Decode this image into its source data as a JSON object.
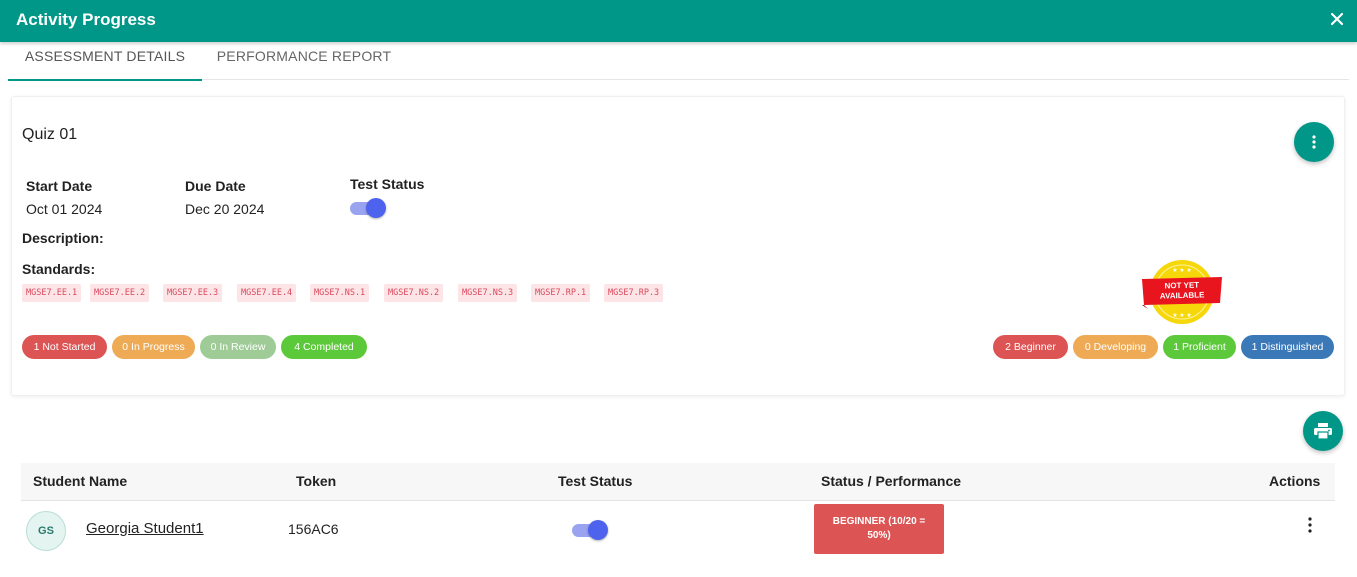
{
  "dialog": {
    "title": "Activity Progress",
    "close_icon": "close-icon"
  },
  "tabs": [
    {
      "label": "ASSESSMENT DETAILS",
      "active": true
    },
    {
      "label": "PERFORMANCE REPORT",
      "active": false
    }
  ],
  "assessment": {
    "title": "Quiz 01",
    "start_date_label": "Start Date",
    "start_date": "Oct 01 2024",
    "due_date_label": "Due Date",
    "due_date": "Dec 20 2024",
    "test_status_label": "Test Status",
    "test_status_on": true,
    "description_label": "Description:",
    "standards_label": "Standards:",
    "standards": [
      "MGSE7.EE.1",
      "MGSE7.EE.2",
      "MGSE7.EE.3",
      "MGSE7.EE.4",
      "MGSE7.NS.1",
      "MGSE7.NS.2",
      "MGSE7.NS.3",
      "MGSE7.RP.1",
      "MGSE7.RP.3"
    ],
    "badge": {
      "line1": "NOT YET",
      "line2": "AVAILABLE"
    }
  },
  "progress_counts": [
    {
      "label": "1 Not Started",
      "color": "#dc5454"
    },
    {
      "label": "0 In Progress",
      "color": "#eeaa55"
    },
    {
      "label": "0 In Review",
      "color": "#9ecb96"
    },
    {
      "label": "4 Completed",
      "color": "#5cc93a"
    }
  ],
  "performance_counts": [
    {
      "label": "2 Beginner",
      "color": "#dc5454"
    },
    {
      "label": "0 Developing",
      "color": "#eeaa55"
    },
    {
      "label": "1 Proficient",
      "color": "#5cc93a"
    },
    {
      "label": "1 Distinguished",
      "color": "#3b78b8"
    }
  ],
  "table": {
    "headers": [
      "Student Name",
      "Token",
      "Test Status",
      "Status / Performance",
      "Actions"
    ],
    "rows": [
      {
        "initials": "GS",
        "name": "Georgia Student1",
        "token": "156AC6",
        "test_status_on": true,
        "performance": "BEGINNER (10/20 = 50%)",
        "performance_color": "#dc5454"
      }
    ]
  },
  "colors": {
    "accent": "#009688",
    "toggle": "#4d63ee"
  }
}
